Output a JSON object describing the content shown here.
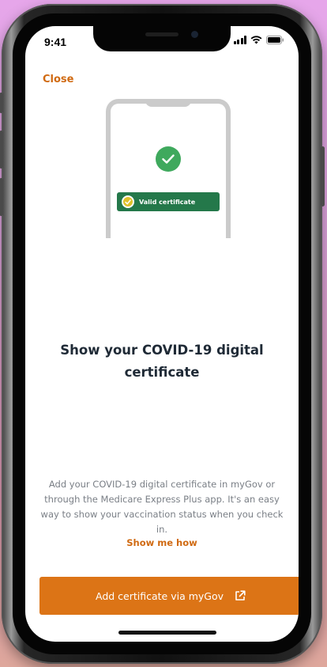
{
  "status_bar": {
    "time": "9:41",
    "icons": [
      "signal-icon",
      "wifi-icon",
      "battery-icon"
    ]
  },
  "header": {
    "close_label": "Close"
  },
  "illustration": {
    "icons": [
      "phone-outline-icon",
      "check-circle-icon",
      "checkmark-badge-icon"
    ],
    "badge_text": "Valid certificate"
  },
  "main": {
    "headline": "Show your COVID-19 digital certificate",
    "body": "Add your COVID-19 digital certificate in myGov or through the Medicare Express Plus app. It's an easy way to show your vaccination status when you check in.",
    "show_me_how": "Show me how"
  },
  "footer": {
    "button_label": "Add certificate via myGov",
    "button_icon": "external-link-icon"
  },
  "colors": {
    "accent": "#dc7416",
    "link": "#d06a12",
    "success": "#3fa95d",
    "badge": "#24784a",
    "heading": "#1f2a36",
    "body_text": "#7a7f86",
    "background_gradient": [
      "#e6a6ea",
      "#dea79c"
    ]
  }
}
